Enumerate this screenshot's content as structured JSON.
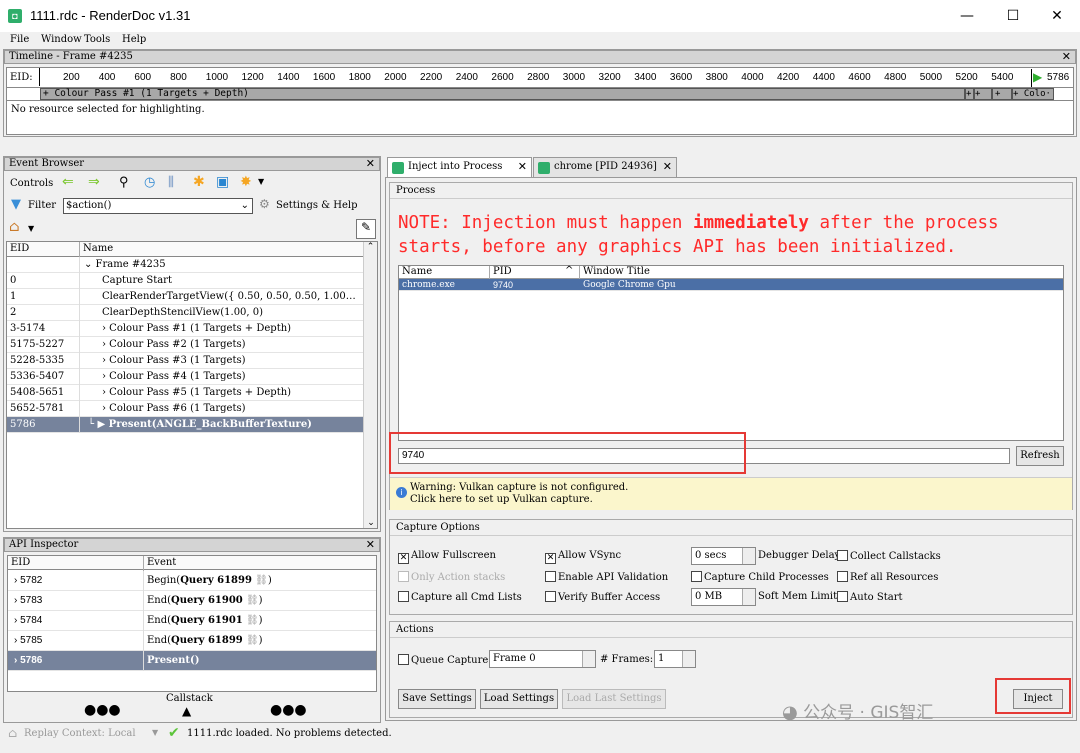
{
  "window": {
    "title": "1111.rdc - RenderDoc v1.31",
    "minimize": "—",
    "maximize": "☐",
    "close": "✕"
  },
  "menu": [
    "File",
    "Window",
    "Tools",
    "Help"
  ],
  "timeline": {
    "title": "Timeline - Frame #4235",
    "eid_label": "EID:",
    "ticks": [
      "200",
      "400",
      "600",
      "800",
      "1000",
      "1200",
      "1400",
      "1600",
      "1800",
      "2000",
      "2200",
      "2400",
      "2600",
      "2800",
      "3000",
      "3200",
      "3400",
      "3600",
      "3800",
      "4000",
      "4200",
      "4400",
      "4600",
      "4800",
      "5000",
      "5200",
      "5400"
    ],
    "current": "5786",
    "section": "+ Colour Pass #1 (1 Targets + Depth)",
    "section_tail": "+ Colo···",
    "status": "No resource selected for highlighting."
  },
  "event_browser": {
    "title": "Event Browser",
    "controls_label": "Controls",
    "filter_label": "Filter",
    "filter_value": "$action()",
    "settings_label": "Settings & Help",
    "columns": [
      "EID",
      "Name"
    ],
    "rows": [
      {
        "eid": "",
        "name": "⌄ Frame #4235"
      },
      {
        "eid": "0",
        "name": "Capture Start"
      },
      {
        "eid": "1",
        "name": "ClearRenderTargetView({ 0.50, 0.50, 0.50, 1.00…"
      },
      {
        "eid": "2",
        "name": "ClearDepthStencilView(1.00, 0)"
      },
      {
        "eid": "3-5174",
        "name": "› Colour Pass #1 (1 Targets + Depth)"
      },
      {
        "eid": "5175-5227",
        "name": "› Colour Pass #2 (1 Targets)"
      },
      {
        "eid": "5228-5335",
        "name": "› Colour Pass #3 (1 Targets)"
      },
      {
        "eid": "5336-5407",
        "name": "› Colour Pass #4 (1 Targets)"
      },
      {
        "eid": "5408-5651",
        "name": "› Colour Pass #5 (1 Targets + Depth)"
      },
      {
        "eid": "5652-5781",
        "name": "› Colour Pass #6 (1 Targets)"
      },
      {
        "eid": "5786",
        "name": "└ ▶ Present(ANGLE_BackBufferTexture)"
      }
    ]
  },
  "api_inspector": {
    "title": "API Inspector",
    "columns": [
      "EID",
      "Event"
    ],
    "rows": [
      {
        "eid": "5782",
        "fn": "Begin(",
        "arg": "Query 61899"
      },
      {
        "eid": "5783",
        "fn": "End(",
        "arg": "Query 61900"
      },
      {
        "eid": "5784",
        "fn": "End(",
        "arg": "Query 61901"
      },
      {
        "eid": "5785",
        "fn": "End(",
        "arg": "Query 61899"
      },
      {
        "eid": "5786",
        "fn": "Present()",
        "arg": ""
      }
    ],
    "callstack": "Callstack"
  },
  "statusbar": {
    "replay": "Replay Context: Local",
    "message": "1111.rdc loaded. No problems detected."
  },
  "tabs": [
    {
      "label": "Inject into Process"
    },
    {
      "label": "chrome [PID 24936]"
    }
  ],
  "process": {
    "title": "Process",
    "note_pre": "NOTE: Injection must happen ",
    "note_bold": "immediately",
    "note_post": " after the process starts, before any graphics API has been initialized.",
    "columns": [
      "Name",
      "PID",
      "Window Title"
    ],
    "rows": [
      {
        "name": "chrome.exe",
        "pid": "9740",
        "title": "Google Chrome Gpu"
      }
    ],
    "pid_input": "9740",
    "refresh": "Refresh",
    "warning1": "Warning: Vulkan capture is not configured.",
    "warning2": "Click here to set up Vulkan capture."
  },
  "capture_options": {
    "title": "Capture Options",
    "allow_fullscreen": "Allow Fullscreen",
    "allow_vsync": "Allow VSync",
    "delay_value": "0 secs",
    "debugger_delay": "Debugger Delay",
    "collect_callstacks": "Collect Callstacks",
    "only_action_stacks": "Only Action stacks",
    "enable_api_validation": "Enable API Validation",
    "capture_child": "Capture Child Processes",
    "ref_all": "Ref all Resources",
    "capture_all_cmd": "Capture all Cmd Lists",
    "verify_buffer": "Verify Buffer Access",
    "mem_value": "0 MB",
    "soft_mem": "Soft Mem Limit",
    "auto_start": "Auto Start"
  },
  "actions": {
    "title": "Actions",
    "queue_capture": "Queue Capture",
    "frame_value": "Frame 0",
    "frames_label": "# Frames:",
    "frames_value": "1",
    "save": "Save Settings",
    "load": "Load Settings",
    "load_last": "Load Last Settings",
    "inject": "Inject"
  },
  "watermark": "公众号 · GIS智汇",
  "colors": {
    "note": "#ff2a2a",
    "selected_row": "#76839c",
    "process_selected": "#4b6fa6",
    "highlight_box": "#e53935"
  }
}
